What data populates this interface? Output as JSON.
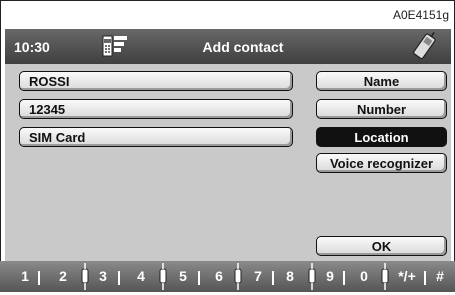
{
  "reference_code": "A0E4151g",
  "header": {
    "time": "10:30",
    "title": "Add contact"
  },
  "fields": [
    "ROSSI",
    "12345",
    "SIM Card"
  ],
  "buttons": [
    {
      "label": "Name",
      "selected": false
    },
    {
      "label": "Number",
      "selected": false
    },
    {
      "label": "Location",
      "selected": true
    },
    {
      "label": "Voice recognizer",
      "selected": false
    },
    {
      "label": "OK",
      "selected": false
    }
  ],
  "keypad": [
    "1",
    "2",
    "3",
    "4",
    "5",
    "6",
    "7",
    "8",
    "9",
    "0",
    "*/+",
    "#"
  ],
  "icons": {
    "header_left": "phonebook-icon",
    "header_right": "mobile-phone-icon",
    "keypad_connector": "plug-icon"
  },
  "colors": {
    "screen_bg": "#c9c9c9",
    "header_bg": "#4a4a4a",
    "selected_bg": "#111111"
  }
}
